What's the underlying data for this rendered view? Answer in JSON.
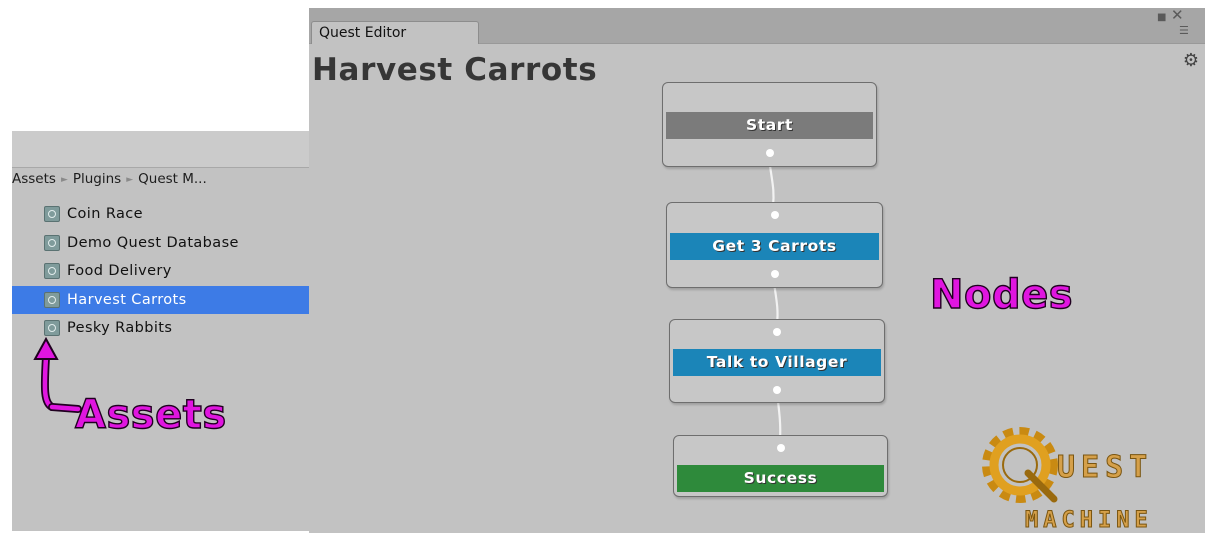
{
  "project": {
    "breadcrumb": [
      "Assets",
      "Plugins",
      "Quest M..."
    ],
    "assets": [
      {
        "label": "Coin Race",
        "selected": false
      },
      {
        "label": "Demo Quest Database",
        "selected": false
      },
      {
        "label": "Food Delivery",
        "selected": false
      },
      {
        "label": "Harvest Carrots",
        "selected": true
      },
      {
        "label": "Pesky Rabbits",
        "selected": false
      }
    ],
    "icon": "quest-asset-icon"
  },
  "editor": {
    "tab_label": "Quest Editor",
    "quest_title": "Harvest Carrots",
    "window_controls": [
      "maximize-icon",
      "close-icon",
      "menu-icon"
    ],
    "settings_icon": "gear-icon"
  },
  "nodes": [
    {
      "label": "Start",
      "color": "#7b7b7b"
    },
    {
      "label": "Get 3 Carrots",
      "color": "#1b85b8"
    },
    {
      "label": "Talk to Villager",
      "color": "#1b85b8"
    },
    {
      "label": "Success",
      "color": "#2e8a3b"
    }
  ],
  "callouts": {
    "nodes": "Nodes",
    "assets": "Assets"
  },
  "logo": {
    "line1": "UEST",
    "line2": "MACHINE",
    "colors": {
      "gear": "#c98a12",
      "text": "#d5a04a"
    }
  }
}
